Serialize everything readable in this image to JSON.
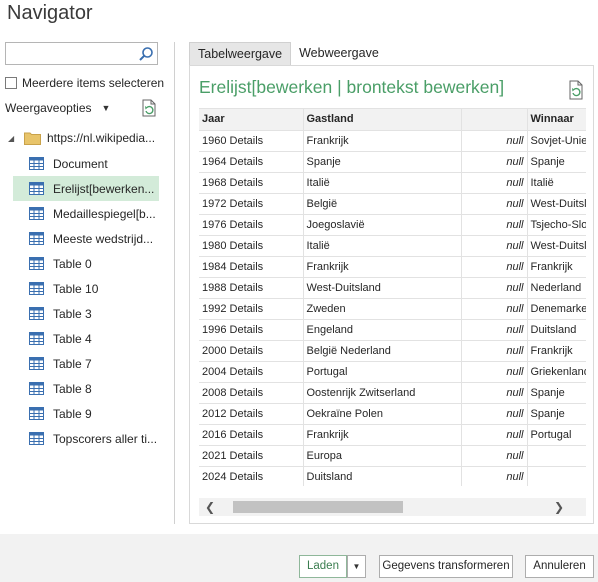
{
  "window": {
    "title": "Navigator"
  },
  "left": {
    "search": {
      "value": "",
      "placeholder": ""
    },
    "multi_select_label": "Meerdere items selecteren",
    "view_options_label": "Weergaveopties",
    "root": "https://nl.wikipedia...",
    "items": [
      {
        "label": "Document",
        "selected": false
      },
      {
        "label": "Erelijst[bewerken...",
        "selected": true
      },
      {
        "label": "Medaillespiegel[b...",
        "selected": false
      },
      {
        "label": "Meeste wedstrijd...",
        "selected": false
      },
      {
        "label": "Table 0",
        "selected": false
      },
      {
        "label": "Table 10",
        "selected": false
      },
      {
        "label": "Table 3",
        "selected": false
      },
      {
        "label": "Table 4",
        "selected": false
      },
      {
        "label": "Table 7",
        "selected": false
      },
      {
        "label": "Table 8",
        "selected": false
      },
      {
        "label": "Table 9",
        "selected": false
      },
      {
        "label": "Topscorers aller ti...",
        "selected": false
      }
    ]
  },
  "right": {
    "tabs": [
      {
        "label": "Tabelweergave",
        "active": true
      },
      {
        "label": "Webweergave",
        "active": false
      }
    ],
    "preview_title": "Erelijst[bewerken | brontekst bewerken]",
    "columns": [
      "Jaar",
      "Gastland",
      "",
      "Winnaar"
    ],
    "rows": [
      [
        "1960 Details",
        "Frankrijk",
        "null",
        "Sovjet-Unie"
      ],
      [
        "1964 Details",
        "Spanje",
        "null",
        "Spanje"
      ],
      [
        "1968 Details",
        "Italië",
        "null",
        "Italië"
      ],
      [
        "1972 Details",
        "België",
        "null",
        "West-Duitsland"
      ],
      [
        "1976 Details",
        "Joegoslavië",
        "null",
        "Tsjecho-Slowakije"
      ],
      [
        "1980 Details",
        "Italië",
        "null",
        "West-Duitsland"
      ],
      [
        "1984 Details",
        "Frankrijk",
        "null",
        "Frankrijk"
      ],
      [
        "1988 Details",
        "West-Duitsland",
        "null",
        "Nederland"
      ],
      [
        "1992 Details",
        "Zweden",
        "null",
        "Denemarken"
      ],
      [
        "1996 Details",
        "Engeland",
        "null",
        "Duitsland"
      ],
      [
        "2000 Details",
        "België  Nederland",
        "null",
        "Frankrijk"
      ],
      [
        "2004 Details",
        "Portugal",
        "null",
        "Griekenland"
      ],
      [
        "2008 Details",
        "Oostenrijk  Zwitserland",
        "null",
        "Spanje"
      ],
      [
        "2012 Details",
        "Oekraïne  Polen",
        "null",
        "Spanje"
      ],
      [
        "2016 Details",
        "Frankrijk",
        "null",
        "Portugal"
      ],
      [
        "2021 Details",
        "Europa",
        "null",
        ""
      ],
      [
        "2024 Details",
        "Duitsland",
        "null",
        ""
      ]
    ],
    "scroll": {
      "left_arrow": "❮",
      "right_arrow": "❯"
    }
  },
  "footer": {
    "load_label": "Laden",
    "dropdown_glyph": "▼",
    "transform_label": "Gegevens transformeren",
    "cancel_label": "Annuleren"
  },
  "colors": {
    "accent_green": "#4a9e67",
    "selected_bg": "#d3ebd9"
  }
}
